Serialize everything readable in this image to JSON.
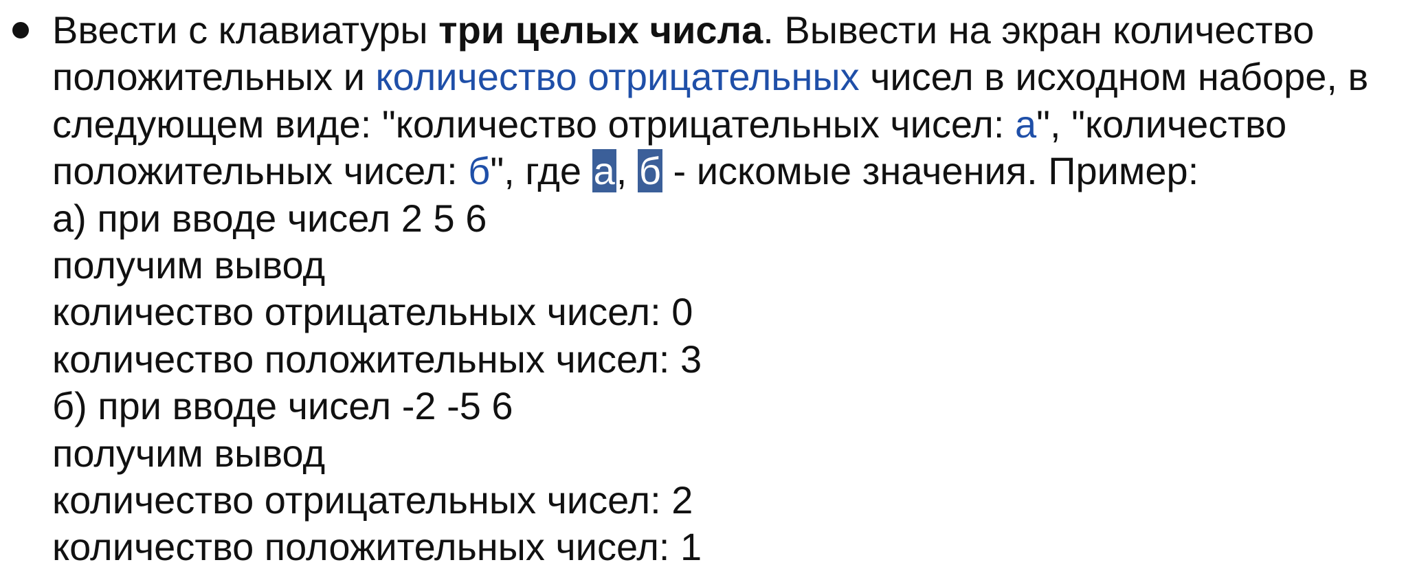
{
  "task": {
    "l1_a": "Ввести с клавиатуры ",
    "l1_bold": "три целых числа",
    "l1_b": ". Вывести на экран количество",
    "l2_a": "положительных и ",
    "l2_blue": "количество отрицательных",
    "l2_b": " чисел в исходном наборе, в",
    "l3_a": "следующем виде: \"количество отрицательных чисел: ",
    "l3_blue": "а",
    "l3_b": "\", \"количество",
    "l4_a": "положительных чисел: ",
    "l4_blue": "б",
    "l4_b": "\", где ",
    "l4_hl1": "а",
    "l4_comma": ", ",
    "l4_hl2": "б",
    "l4_c": " - искомые значения. Пример:"
  },
  "example_a": {
    "input": "а) при вводе чисел 2 5 6",
    "output_label": "получим вывод",
    "neg": "количество отрицательных чисел: 0",
    "pos": "количество положительных чисел: 3"
  },
  "example_b": {
    "input": "б) при вводе чисел -2 -5 6",
    "output_label": "получим вывод",
    "neg": "количество отрицательных чисел: 2",
    "pos": "количество положительных чисел: 1"
  }
}
